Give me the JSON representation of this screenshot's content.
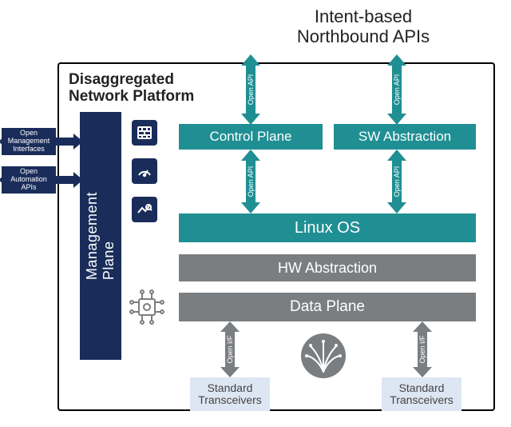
{
  "title": "Intent-based\nNorthbound APIs",
  "platform_title": "Disaggregated\nNetwork Platform",
  "mgmt_plane": "Management\nPlane",
  "open_mgmt": "Open Management\nInterfaces",
  "open_auto": "Open Automation\nAPIs",
  "layers": {
    "control": "Control Plane",
    "sw_abs": "SW Abstraction",
    "linux": "Linux OS",
    "hw_abs": "HW Abstraction",
    "data": "Data Plane",
    "trans1": "Standard\nTransceivers",
    "trans2": "Standard\nTransceivers"
  },
  "arrow_labels": {
    "open_api": "Open API",
    "open_if": "Open I/F"
  },
  "icons": {
    "firewall": "firewall-icon",
    "gauge": "gauge-icon",
    "chart": "chart-icon",
    "chip": "chip-icon",
    "fiber": "fiber-icon"
  }
}
